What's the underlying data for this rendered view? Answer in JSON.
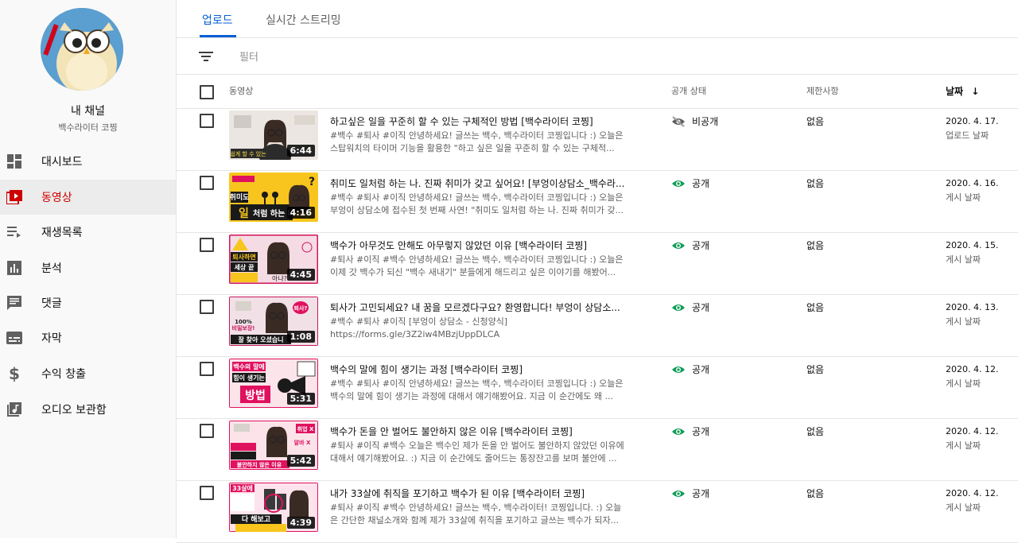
{
  "channel": {
    "title": "내 채널",
    "subtitle": "백수라이터 코찡"
  },
  "sidebar": {
    "items": [
      {
        "label": "대시보드",
        "icon": "dashboard-icon"
      },
      {
        "label": "동영상",
        "icon": "video-icon",
        "active": true
      },
      {
        "label": "재생목록",
        "icon": "playlist-icon"
      },
      {
        "label": "분석",
        "icon": "analytics-icon"
      },
      {
        "label": "댓글",
        "icon": "comments-icon"
      },
      {
        "label": "자막",
        "icon": "subtitles-icon"
      },
      {
        "label": "수익 창출",
        "icon": "dollar-icon"
      },
      {
        "label": "오디오 보관함",
        "icon": "audio-library-icon"
      }
    ]
  },
  "tabs": [
    {
      "label": "업로드",
      "active": true
    },
    {
      "label": "실시간 스트리밍"
    }
  ],
  "filter": {
    "label": "필터"
  },
  "table": {
    "headers": {
      "video": "동영상",
      "visibility": "공개 상태",
      "restrictions": "제한사항",
      "date": "날짜"
    },
    "rows": [
      {
        "title": "하고싶은 일을 꾸준히 할 수 있는 구체적인 방법 [백수라이터 코찡]",
        "desc1": "#백수 #퇴사 #이직 안녕하세요! 글쓰는 백수, 백수라이터 코찡입니다 :) 오늘은",
        "desc2": "스탑워치의 타이머 기능을 활용한 \"하고 싶은 일을 꾸준히 할 수 있는 구체적...",
        "duration": "6:44",
        "visibility": "비공개",
        "restrictions": "없음",
        "date": "2020. 4. 17.",
        "date_sub": "업로드 날짜",
        "thumb_text": "쉽게 할 수 있는 방법",
        "thumb_colors": {
          "bg": "#e9e4df",
          "accent": "#3b3b3b"
        }
      },
      {
        "title": "취미도 일처럼 하는 나. 진짜 취미가 갖고 싶어요! [부엉이상담소_백수라...",
        "desc1": "#백수 #퇴사 #이직 안녕하세요! 글쓰는 백수, 백수라이터 코찡입니다 :) 오늘은",
        "desc2": "부엉이 상담소에 접수된 첫 번째 사연! \"취미도 일처럼 하는 나. 진짜 취미가 갖...",
        "duration": "4:16",
        "visibility": "공개",
        "restrictions": "없음",
        "date": "2020. 4. 16.",
        "date_sub": "게시 날짜",
        "thumb_text": "일처럼 하는 나",
        "thumb_colors": {
          "bg": "#f7c51e",
          "accent": "#1a1a1a"
        }
      },
      {
        "title": "백수가 아무것도 안해도 아무렇지 않았던 이유 [백수라이터 코찡]",
        "desc1": "#퇴사 #이직 #백수 안녕하세요! 글쓰는 백수, 백수라이터 코찡입니다 :) 오늘은",
        "desc2": "이제 갓 백수가 되신 \"백수 새내기\" 분들에게 해드리고 싶은 이야기를 해봤어...",
        "duration": "4:45",
        "visibility": "공개",
        "restrictions": "없음",
        "date": "2020. 4. 15.",
        "date_sub": "게시 날짜",
        "thumb_text": "퇴사하면 세상 끝",
        "thumb_colors": {
          "bg": "#f4dbe4",
          "accent": "#d4145a"
        }
      },
      {
        "title": "퇴사가 고민되세요? 내 꿈을 모르겠다구요? 환영합니다! 부엉이 상담소...",
        "desc1": "#백수 #퇴사 #이직 [부엉이 상담소 - 신청양식]",
        "desc2": "https://forms.gle/3Z2iw4MBzjUppDLCA",
        "duration": "1:08",
        "visibility": "공개",
        "restrictions": "없음",
        "date": "2020. 4. 13.",
        "date_sub": "게시 날짜",
        "thumb_text": "잘 찾아 오셨습니",
        "thumb_colors": {
          "bg": "#f1e1e6",
          "accent": "#c8175d"
        }
      },
      {
        "title": "백수의 말에 힘이 생기는 과정 [백수라이터 코찡]",
        "desc1": "#백수 #퇴사 #이직 안녕하세요! 글쓰는 백수, 백수라이터 코찡입니다 :) 오늘은",
        "desc2": "백수의 말에 힘이 생기는 과정에 대해서 얘기해봤어요. 지금 이 순간에도 왜 ...",
        "duration": "5:31",
        "visibility": "공개",
        "restrictions": "없음",
        "date": "2020. 4. 12.",
        "date_sub": "게시 날짜",
        "thumb_text": "방법",
        "thumb_colors": {
          "bg": "#fbe4ea",
          "accent": "#e0115f"
        }
      },
      {
        "title": "백수가 돈을 안 벌어도 불안하지 않은 이유 [백수라이터 코찡]",
        "desc1": "#퇴사 #이직 #백수 오늘은 백수인 제가 돈을 안 벌어도 불안하지 않았던 이유에",
        "desc2": "대해서 얘기해봤어요. :) 지금 이 순간에도 줄어드는 통장잔고를 보며 불안에 ...",
        "duration": "5:42",
        "visibility": "공개",
        "restrictions": "없음",
        "date": "2020. 4. 12.",
        "date_sub": "게시 날짜",
        "thumb_text": "불안하지 않은 이유",
        "thumb_colors": {
          "bg": "#fce3e9",
          "accent": "#e0115f"
        }
      },
      {
        "title": "내가 33살에 취직을 포기하고 백수가 된 이유 [백수라이터 코찡]",
        "desc1": "#퇴사 #이직 #백수 안녕하세요! 글쓰는 백수, 백수라이터! 코찡입니다. :) 오늘",
        "desc2": "은 간단한 채널소개와 함께 제가 33살에 취직을 포기하고 글쓰는 백수가 되자...",
        "duration": "4:39",
        "visibility": "공개",
        "restrictions": "없음",
        "date": "2020. 4. 12.",
        "date_sub": "게시 날짜",
        "thumb_text": "다 해보고",
        "thumb_colors": {
          "bg": "#fde4ec",
          "accent": "#e0115f"
        }
      }
    ]
  },
  "colors": {
    "accent_blue": "#065fd4",
    "active_red": "#cc0000",
    "public_green": "#0f9d58",
    "sidebar_bg": "#f9f9f9"
  }
}
